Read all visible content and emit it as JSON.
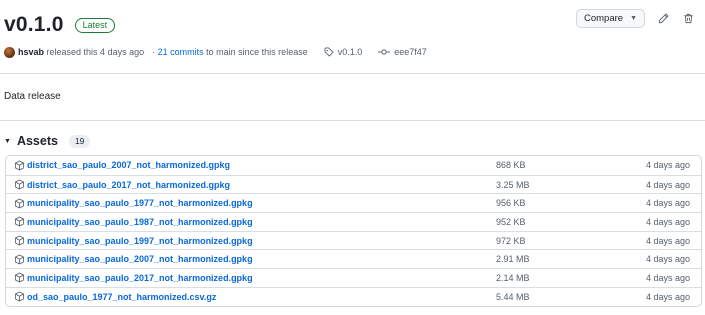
{
  "release": {
    "version": "v0.1.0",
    "badge": "Latest",
    "compare_label": "Compare",
    "author": "hsvab",
    "released_text": "released this 4 days ago",
    "commits_separator": "·",
    "commits_link": "21 commits",
    "commits_suffix": "to main since this release",
    "tag": "v0.1.0",
    "commit_sha": "eee7f47",
    "body": "Data release"
  },
  "assets": {
    "title": "Assets",
    "count": "19",
    "items": [
      {
        "name": "district_sao_paulo_2007_not_harmonized.gpkg",
        "size": "868 KB",
        "date": "4 days ago"
      },
      {
        "name": "district_sao_paulo_2017_not_harmonized.gpkg",
        "size": "3.25 MB",
        "date": "4 days ago"
      },
      {
        "name": "municipality_sao_paulo_1977_not_harmonized.gpkg",
        "size": "956 KB",
        "date": "4 days ago"
      },
      {
        "name": "municipality_sao_paulo_1987_not_harmonized.gpkg",
        "size": "952 KB",
        "date": "4 days ago"
      },
      {
        "name": "municipality_sao_paulo_1997_not_harmonized.gpkg",
        "size": "972 KB",
        "date": "4 days ago"
      },
      {
        "name": "municipality_sao_paulo_2007_not_harmonized.gpkg",
        "size": "2.91 MB",
        "date": "4 days ago"
      },
      {
        "name": "municipality_sao_paulo_2017_not_harmonized.gpkg",
        "size": "2.14 MB",
        "date": "4 days ago"
      },
      {
        "name": "od_sao_paulo_1977_not_harmonized.csv.gz",
        "size": "5.44 MB",
        "date": "4 days ago"
      }
    ]
  },
  "icons": {
    "edit": "pencil-icon",
    "delete": "trash-icon",
    "tag": "tag-icon",
    "commit": "git-commit-icon",
    "asset": "package-icon",
    "collapse": "triangle-down-icon",
    "dropdown": "caret-down-icon"
  },
  "colors": {
    "link": "#0969da",
    "latest": "#1a7f37",
    "muted": "#57606a",
    "text": "#1f2328",
    "border": "#d0d7de"
  }
}
